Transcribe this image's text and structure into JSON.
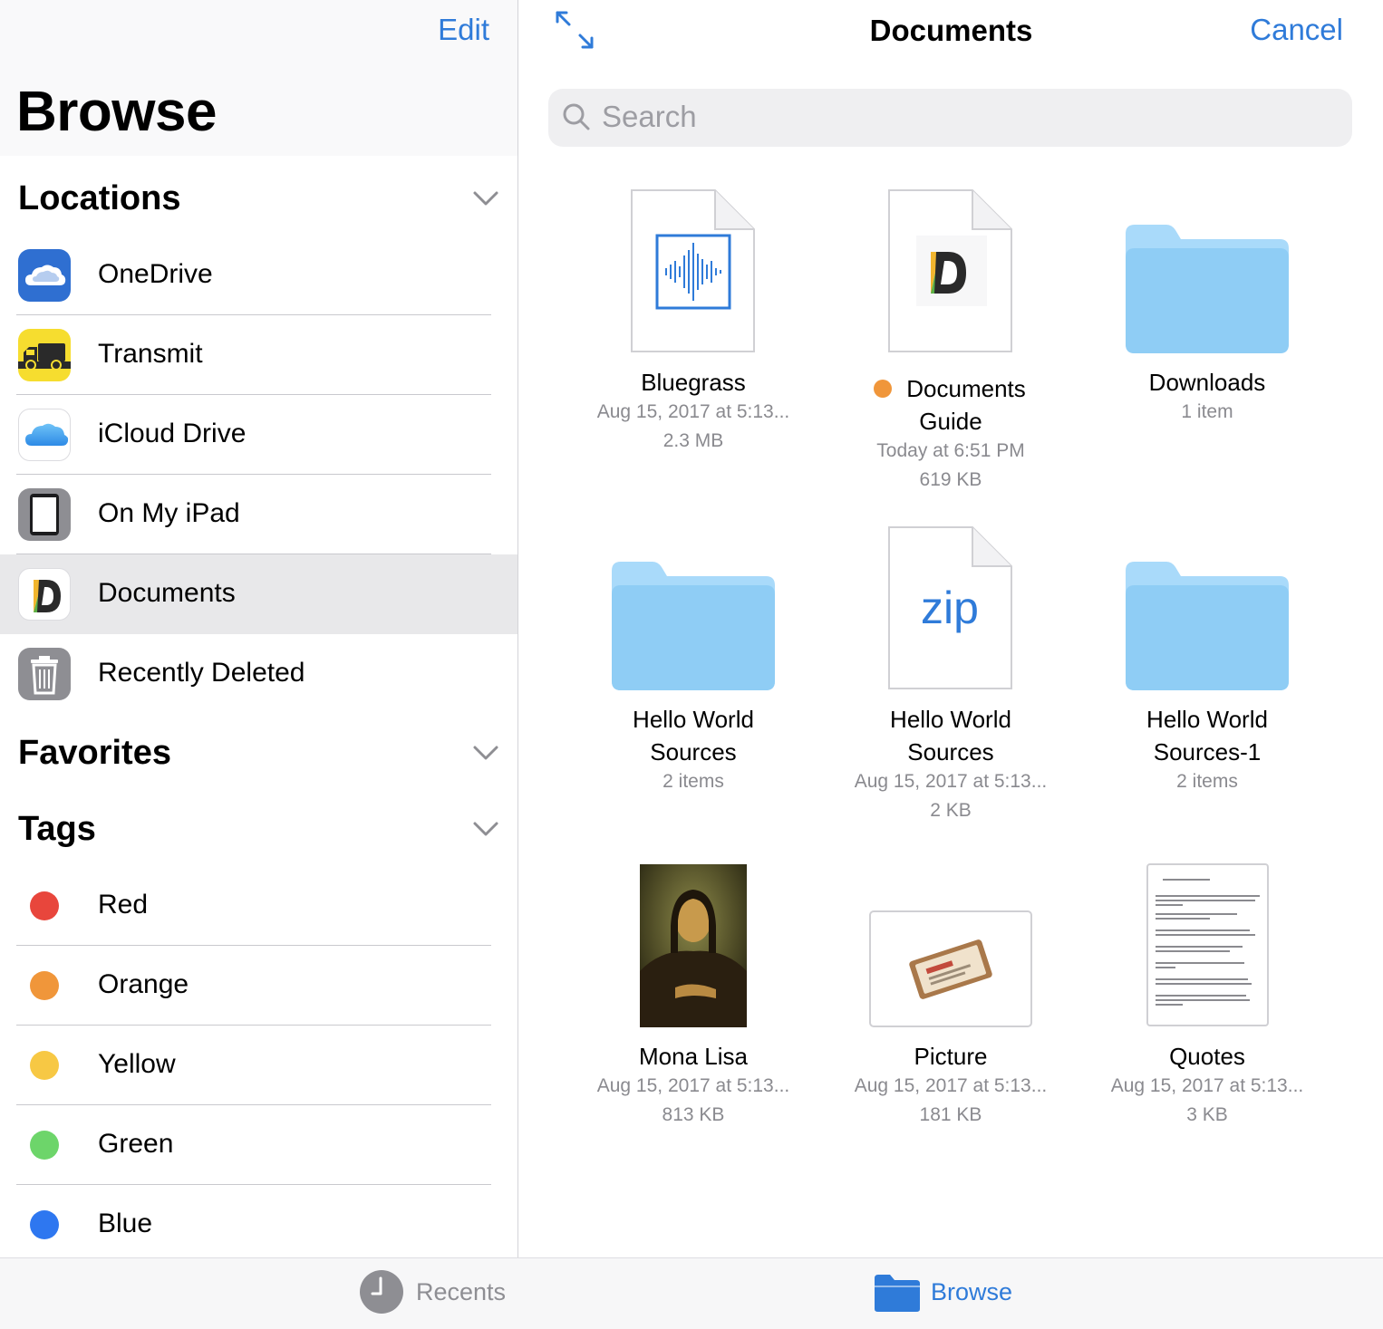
{
  "sidebar": {
    "edit_label": "Edit",
    "title": "Browse",
    "locations_label": "Locations",
    "locations": [
      {
        "label": "OneDrive",
        "icon": "onedrive-icon"
      },
      {
        "label": "Transmit",
        "icon": "transmit-truck-icon"
      },
      {
        "label": "iCloud Drive",
        "icon": "icloud-icon"
      },
      {
        "label": "On My iPad",
        "icon": "ipad-icon"
      },
      {
        "label": "Documents",
        "icon": "documents-app-icon",
        "selected": true
      },
      {
        "label": "Recently Deleted",
        "icon": "trash-icon"
      }
    ],
    "favorites_label": "Favorites",
    "tags_label": "Tags",
    "tags": [
      {
        "label": "Red",
        "color": "#e8463c"
      },
      {
        "label": "Orange",
        "color": "#f0963a"
      },
      {
        "label": "Yellow",
        "color": "#f7c844"
      },
      {
        "label": "Green",
        "color": "#6dd56a"
      },
      {
        "label": "Blue",
        "color": "#2e77f0"
      }
    ]
  },
  "navbar": {
    "title": "Documents",
    "cancel_label": "Cancel"
  },
  "search": {
    "placeholder": "Search"
  },
  "files": [
    {
      "name_line1": "Bluegrass",
      "name_line2": "",
      "meta1": "Aug 15, 2017 at 5:13...",
      "meta2": "2.3 MB",
      "kind": "audio",
      "icon": "audio-waveform-icon"
    },
    {
      "name_line1": "Documents",
      "name_line2": "Guide",
      "meta1": "Today at 6:51 PM",
      "meta2": "619 KB",
      "kind": "document",
      "icon": "documents-app-icon",
      "tag_color": "#f0963a"
    },
    {
      "name_line1": "Downloads",
      "name_line2": "",
      "meta1": "1 item",
      "meta2": "",
      "kind": "folder",
      "icon": "folder-icon"
    },
    {
      "name_line1": "Hello World",
      "name_line2": "Sources",
      "meta1": "2 items",
      "meta2": "",
      "kind": "folder",
      "icon": "folder-icon"
    },
    {
      "name_line1": "Hello World",
      "name_line2": "Sources",
      "meta1": "Aug 15, 2017 at 5:13...",
      "meta2": "2 KB",
      "kind": "zip",
      "icon": "zip-file-icon",
      "zip_text": "zip"
    },
    {
      "name_line1": "Hello World",
      "name_line2": "Sources-1",
      "meta1": "2 items",
      "meta2": "",
      "kind": "folder",
      "icon": "folder-icon"
    },
    {
      "name_line1": "Mona Lisa",
      "name_line2": "",
      "meta1": "Aug 15, 2017 at 5:13...",
      "meta2": "813 KB",
      "kind": "image",
      "icon": "mona-lisa-thumbnail"
    },
    {
      "name_line1": "Picture",
      "name_line2": "",
      "meta1": "Aug 15, 2017 at 5:13...",
      "meta2": "181 KB",
      "kind": "picture",
      "icon": "picture-frame-icon"
    },
    {
      "name_line1": "Quotes",
      "name_line2": "",
      "meta1": "Aug 15, 2017 at 5:13...",
      "meta2": "3 KB",
      "kind": "text",
      "icon": "text-document-thumbnail"
    }
  ],
  "tabbar": {
    "recents_label": "Recents",
    "browse_label": "Browse"
  },
  "colors": {
    "accent": "#2f7bd9",
    "folder": "#8fcdf5",
    "selected_row": "#e8e8ea"
  }
}
